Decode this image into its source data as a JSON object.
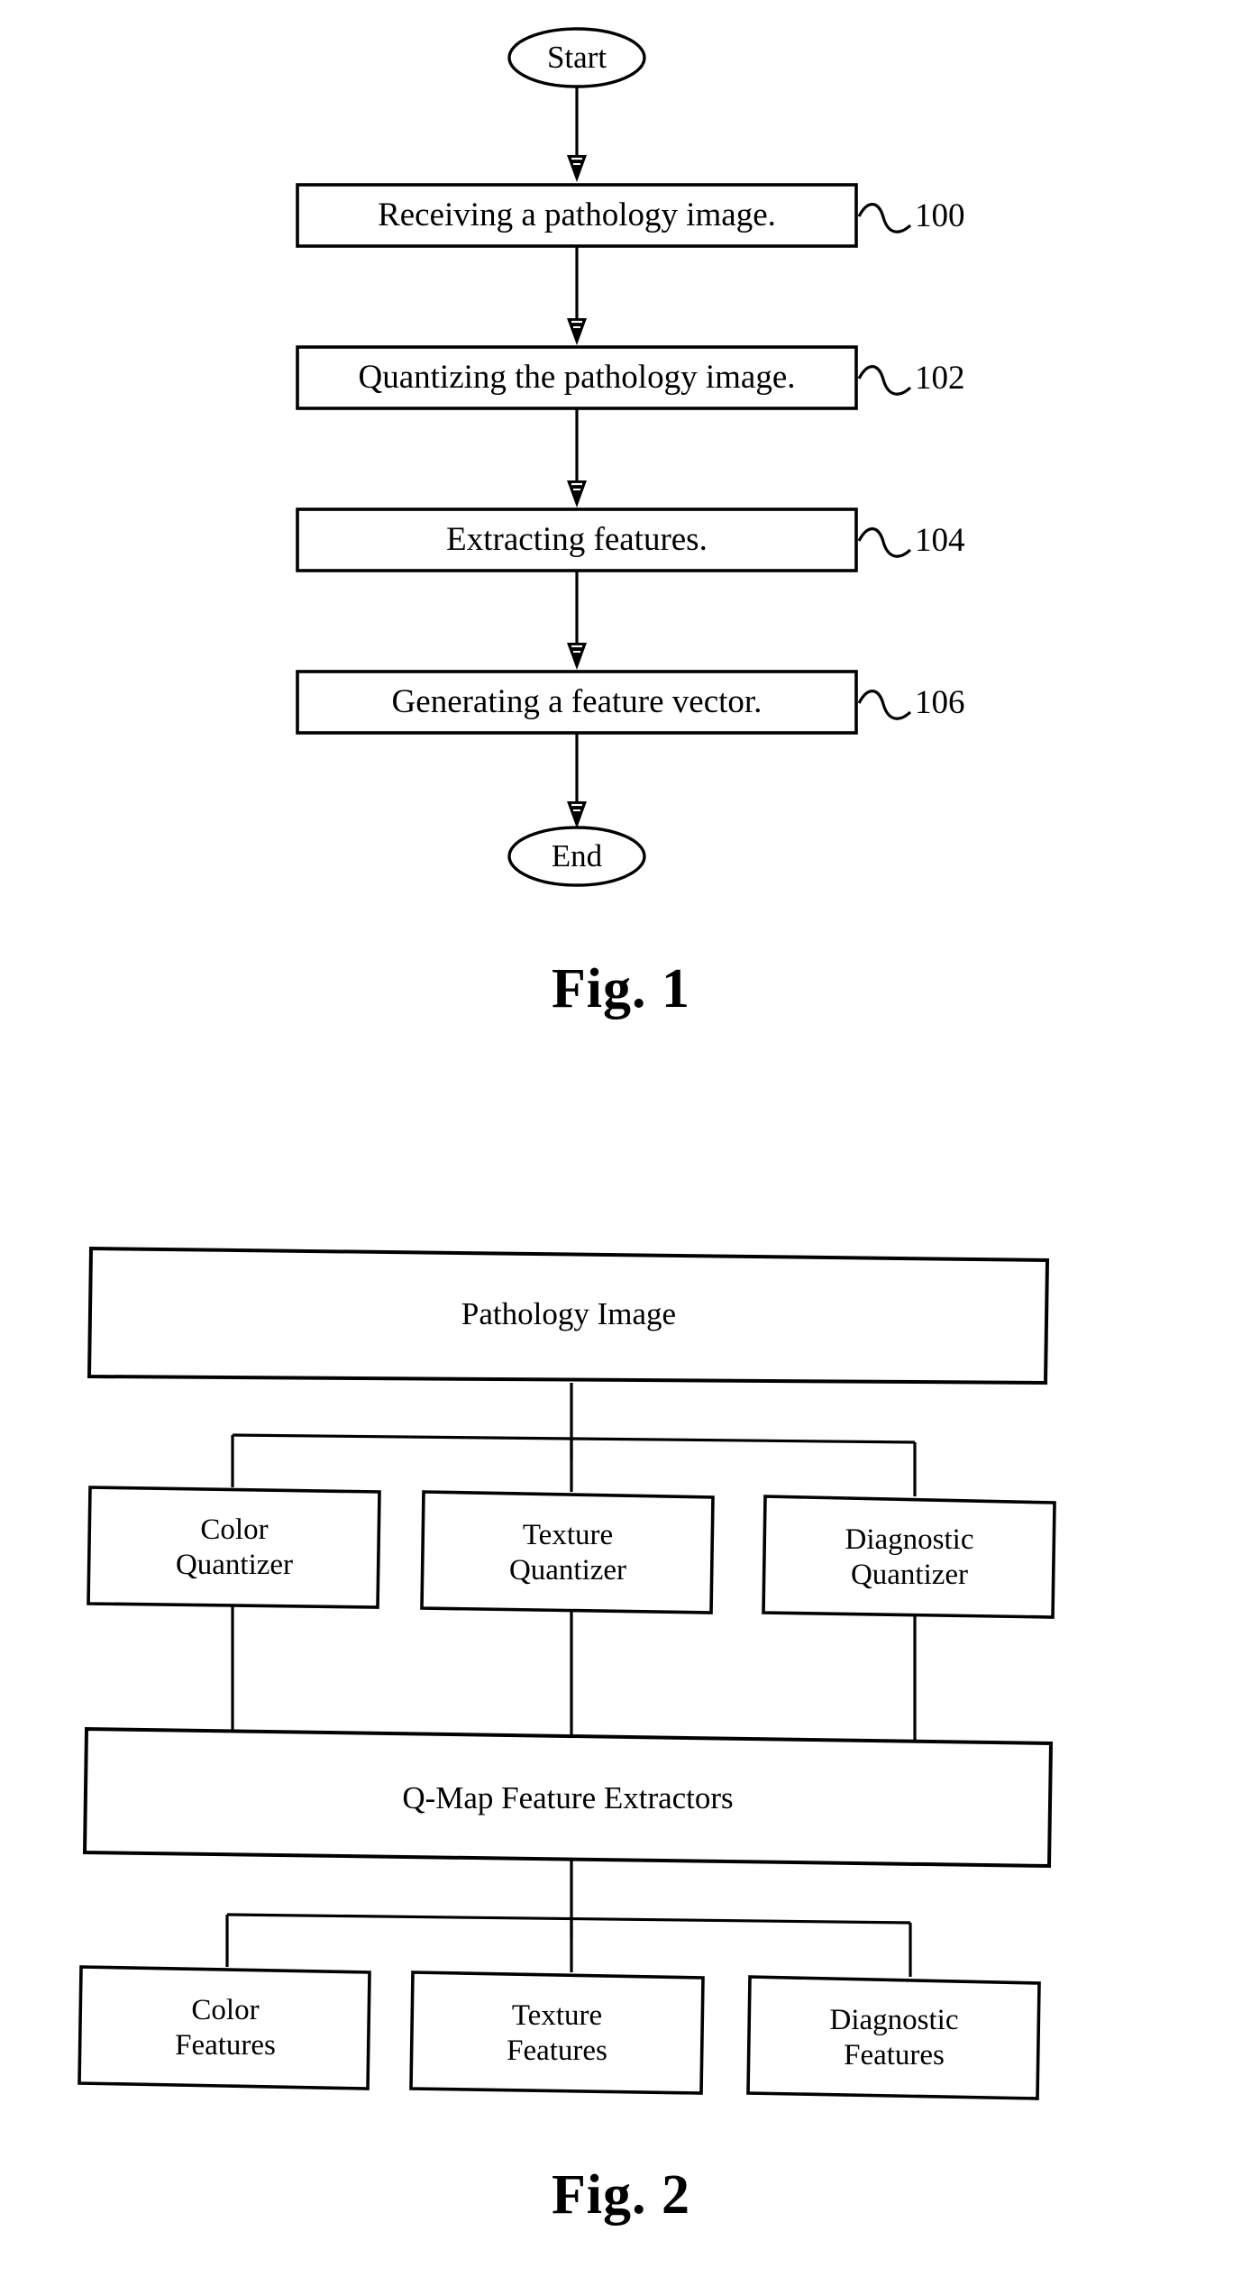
{
  "document": {
    "type": "patent-figure-sheet",
    "figures": [
      {
        "id": "fig1",
        "caption": "Fig. 1",
        "type": "flowchart",
        "nodes": [
          {
            "id": "start",
            "shape": "ellipse",
            "label": "Start",
            "ref": ""
          },
          {
            "id": "s100",
            "shape": "rect",
            "label": "Receiving a pathology image.",
            "ref": "100"
          },
          {
            "id": "s102",
            "shape": "rect",
            "label": "Quantizing the pathology image.",
            "ref": "102"
          },
          {
            "id": "s104",
            "shape": "rect",
            "label": "Extracting features.",
            "ref": "104"
          },
          {
            "id": "s106",
            "shape": "rect",
            "label": "Generating a feature vector.",
            "ref": "106"
          },
          {
            "id": "end",
            "shape": "ellipse",
            "label": "End",
            "ref": ""
          }
        ],
        "edges": [
          {
            "from": "start",
            "to": "s100",
            "arrow": true
          },
          {
            "from": "s100",
            "to": "s102",
            "arrow": true
          },
          {
            "from": "s102",
            "to": "s104",
            "arrow": true
          },
          {
            "from": "s104",
            "to": "s106",
            "arrow": true
          },
          {
            "from": "s106",
            "to": "end",
            "arrow": true
          }
        ]
      },
      {
        "id": "fig2",
        "caption": "Fig. 2",
        "type": "block-diagram",
        "nodes": [
          {
            "id": "b-image",
            "label": "Pathology Image"
          },
          {
            "id": "b-cq",
            "label": "Color\nQuantizer"
          },
          {
            "id": "b-tq",
            "label": "Texture\nQuantizer"
          },
          {
            "id": "b-dq",
            "label": "Diagnostic\nQuantizer"
          },
          {
            "id": "b-qmap",
            "label": "Q-Map Feature Extractors"
          },
          {
            "id": "b-cf",
            "label": "Color\nFeatures"
          },
          {
            "id": "b-tf",
            "label": "Texture\nFeatures"
          },
          {
            "id": "b-df",
            "label": "Diagnostic\nFeatures"
          }
        ],
        "edges": [
          {
            "from": "b-image",
            "to": "b-cq"
          },
          {
            "from": "b-image",
            "to": "b-tq"
          },
          {
            "from": "b-image",
            "to": "b-dq"
          },
          {
            "from": "b-cq",
            "to": "b-qmap"
          },
          {
            "from": "b-tq",
            "to": "b-qmap"
          },
          {
            "from": "b-dq",
            "to": "b-qmap"
          },
          {
            "from": "b-qmap",
            "to": "b-cf"
          },
          {
            "from": "b-qmap",
            "to": "b-tf"
          },
          {
            "from": "b-qmap",
            "to": "b-df"
          }
        ]
      }
    ],
    "colors": {
      "ink": "#000000",
      "paper": "#ffffff"
    }
  }
}
